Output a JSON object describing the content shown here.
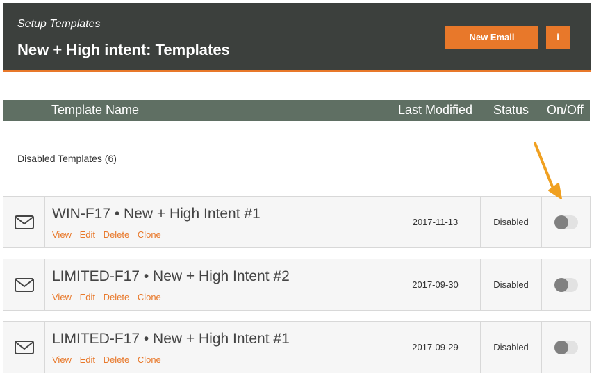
{
  "header": {
    "crumb": "Setup Templates",
    "title": "New + High intent: Templates",
    "new_email_label": "New Email",
    "info_label": "i"
  },
  "columns": {
    "name": "Template Name",
    "modified": "Last Modified",
    "status": "Status",
    "onoff": "On/Off"
  },
  "group": {
    "label": "Disabled Templates (6)"
  },
  "actions": {
    "view": "View",
    "edit": "Edit",
    "delete": "Delete",
    "clone": "Clone"
  },
  "rows": [
    {
      "name": "WIN-F17 • New + High Intent #1",
      "modified": "2017-11-13",
      "status": "Disabled",
      "enabled": false
    },
    {
      "name": "LIMITED-F17 • New + High Intent #2",
      "modified": "2017-09-30",
      "status": "Disabled",
      "enabled": false
    },
    {
      "name": "LIMITED-F17 • New + High Intent #1",
      "modified": "2017-09-29",
      "status": "Disabled",
      "enabled": false
    }
  ],
  "colors": {
    "accent": "#e8782a",
    "header_bg": "#3c403d",
    "table_header_bg": "#5f6f63",
    "arrow": "#f0a020"
  },
  "icons": {
    "row_icon": "envelope-icon",
    "annotation": "arrow-icon"
  }
}
